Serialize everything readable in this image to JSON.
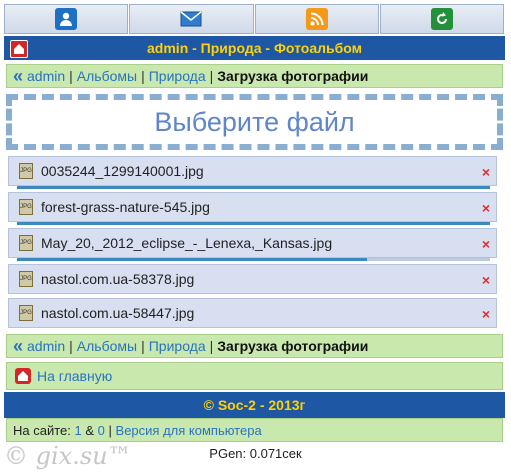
{
  "colors": {
    "header_bg": "#1e57a4",
    "header_text": "#ffd200",
    "crumb_bg": "#c8e8ad",
    "link": "#2a72c2",
    "file_bg": "#d7dff0",
    "delete": "#e32b2b",
    "progress": "#3b89bd"
  },
  "topnav": {
    "icons": [
      "user-icon",
      "mail-icon",
      "rss-icon",
      "refresh-icon"
    ]
  },
  "header": {
    "title": "admin - Природа - Фотоальбом"
  },
  "breadcrumb": {
    "back": "«",
    "items": [
      "admin",
      "Альбомы",
      "Природа"
    ],
    "current": "Загрузка фотографии",
    "separator": "|"
  },
  "upload": {
    "label": "Выберите файл"
  },
  "files": [
    {
      "name": "0035244_1299140001.jpg",
      "progress": 1.0,
      "delete": "×"
    },
    {
      "name": "forest-grass-nature-545.jpg",
      "progress": 1.0,
      "delete": "×"
    },
    {
      "name": "May_20,_2012_eclipse_-_Lenexa,_Kansas.jpg",
      "progress": 0.74,
      "delete": "×"
    },
    {
      "name": "nastol.com.ua-58378.jpg",
      "progress": 0,
      "delete": "×"
    },
    {
      "name": "nastol.com.ua-58447.jpg",
      "progress": 0,
      "delete": "×"
    }
  ],
  "home_link": {
    "label": "На главную"
  },
  "footer": {
    "copyright": "© Soc-2 - 2013г"
  },
  "online": {
    "prefix": "На сайте:",
    "users": "1",
    "amp": "&",
    "guests": "0",
    "sep": "|",
    "desktop_link": "Версия для компьютера"
  },
  "pgen": {
    "text": "PGen: 0.071сек"
  },
  "watermark": {
    "text": "© gix.su™"
  }
}
